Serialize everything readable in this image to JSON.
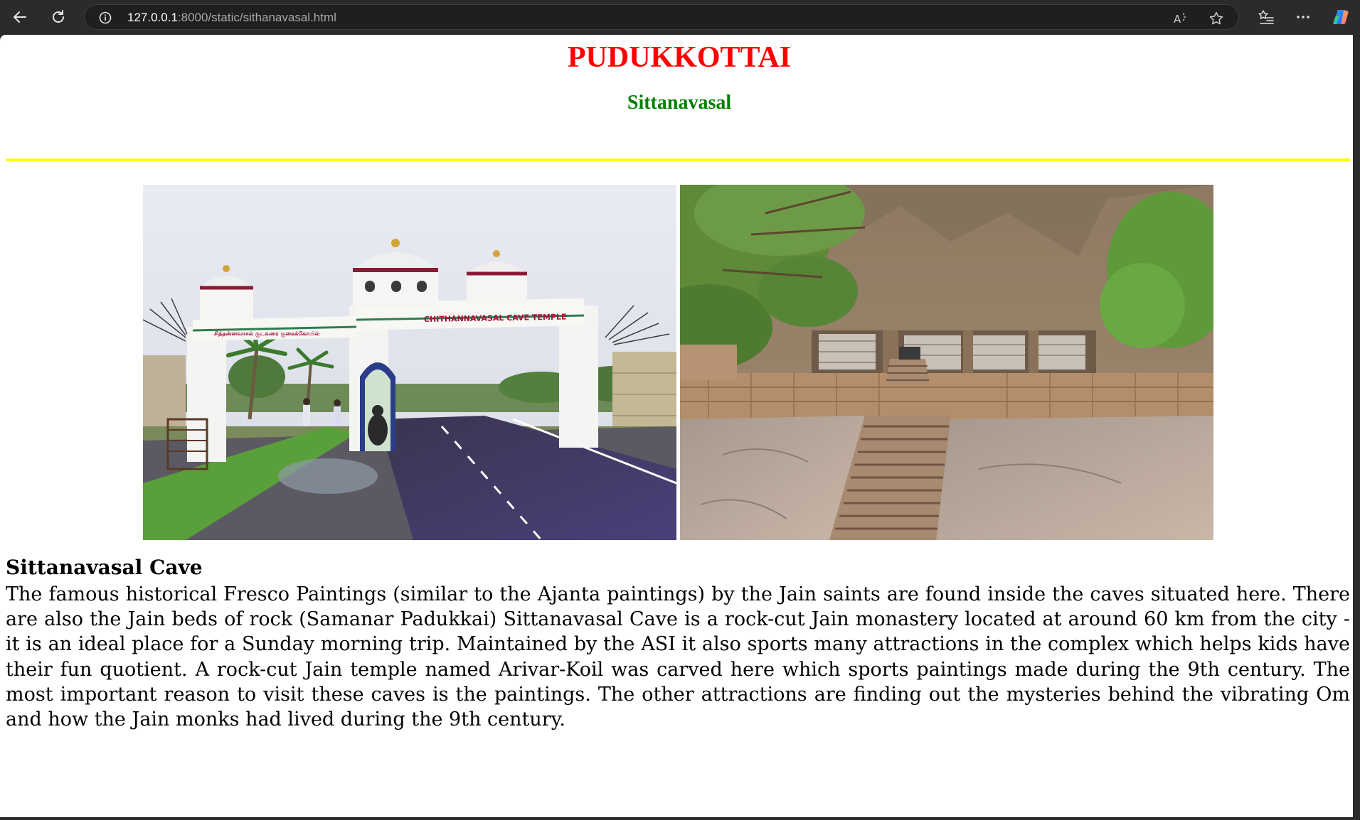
{
  "browser": {
    "url_host": "127.0.0.1",
    "url_path": ":8000/static/sithanavasal.html",
    "icons": [
      "back-icon",
      "refresh-icon",
      "info-icon",
      "read-aloud-icon",
      "favorite-star-icon",
      "favorites-list-icon",
      "more-options-icon",
      "copilot-icon"
    ]
  },
  "page": {
    "title": "PUDUKKOTTAI",
    "subtitle": "Sittanavasal",
    "title_color": "#ff0000",
    "subtitle_color": "#008000",
    "rule_color": "#ffff00",
    "images": [
      {
        "name": "cave-temple-entrance-arch",
        "sign_text": "CHITHANNAVASAL CAVE TEMPLE"
      },
      {
        "name": "rock-cut-cave-steps"
      }
    ],
    "section": {
      "heading": "Sittanavasal Cave",
      "text": "The famous historical Fresco Paintings (similar to the Ajanta paintings) by the Jain saints are found inside the caves situated here. There are also the Jain beds of rock (Samanar Padukkai) Sittanavasal Cave is a rock-cut Jain monastery located at around 60 km from the city - it is an ideal place for a Sunday morning trip. Maintained by the ASI it also sports many attractions in the complex which helps kids have their fun quotient. A rock-cut Jain temple named Arivar-Koil was carved here which sports paintings made during the 9th century. The most important reason to visit these caves is the paintings. The other attractions are finding out the mysteries behind the vibrating Om and how the Jain monks had lived during the 9th century."
    }
  }
}
